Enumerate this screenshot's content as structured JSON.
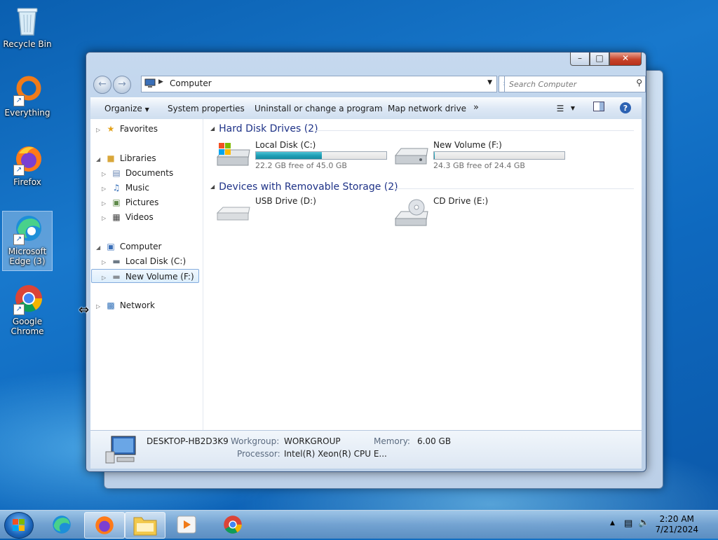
{
  "desktop": {
    "icons": [
      {
        "label": "Recycle Bin"
      },
      {
        "label": "Everything"
      },
      {
        "label": "Firefox"
      },
      {
        "label": "Microsoft Edge (3)"
      },
      {
        "label": "Google Chrome"
      }
    ]
  },
  "window": {
    "address": "Computer",
    "search_placeholder": "Search Computer",
    "caption": {
      "minimize": "–",
      "maximize": "□",
      "close": "✕"
    }
  },
  "toolbar": {
    "organize": "Organize",
    "system_properties": "System properties",
    "uninstall": "Uninstall or change a program",
    "map_drive": "Map network drive",
    "more": "»"
  },
  "nav": {
    "favorites": "Favorites",
    "libraries": "Libraries",
    "documents": "Documents",
    "music": "Music",
    "pictures": "Pictures",
    "videos": "Videos",
    "computer": "Computer",
    "local_disk": "Local Disk (C:)",
    "new_volume": "New Volume (F:)",
    "network": "Network"
  },
  "groups": {
    "hard_disks": "Hard Disk Drives (2)",
    "removable": "Devices with Removable Storage (2)"
  },
  "drives": [
    {
      "name": "Local Disk (C:)",
      "free": "22.2 GB free of 45.0 GB",
      "used_fraction": 0.507
    },
    {
      "name": "New Volume (F:)",
      "free": "24.3 GB free of 24.4 GB",
      "used_fraction": 0.004
    },
    {
      "name": "USB Drive (D:)"
    },
    {
      "name": "CD Drive (E:)"
    }
  ],
  "details": {
    "computer_name": "DESKTOP-HB2D3K9",
    "workgroup_label": "Workgroup:",
    "workgroup": "WORKGROUP",
    "memory_label": "Memory:",
    "memory": "6.00 GB",
    "processor_label": "Processor:",
    "processor": "Intel(R) Xeon(R) CPU E..."
  },
  "taskbar": {
    "time": "2:20 AM",
    "date": "7/21/2024"
  },
  "colors": {
    "accent": "#1e3287",
    "drive_fill": "#1f9fb6",
    "close_button": "#c7432a"
  }
}
